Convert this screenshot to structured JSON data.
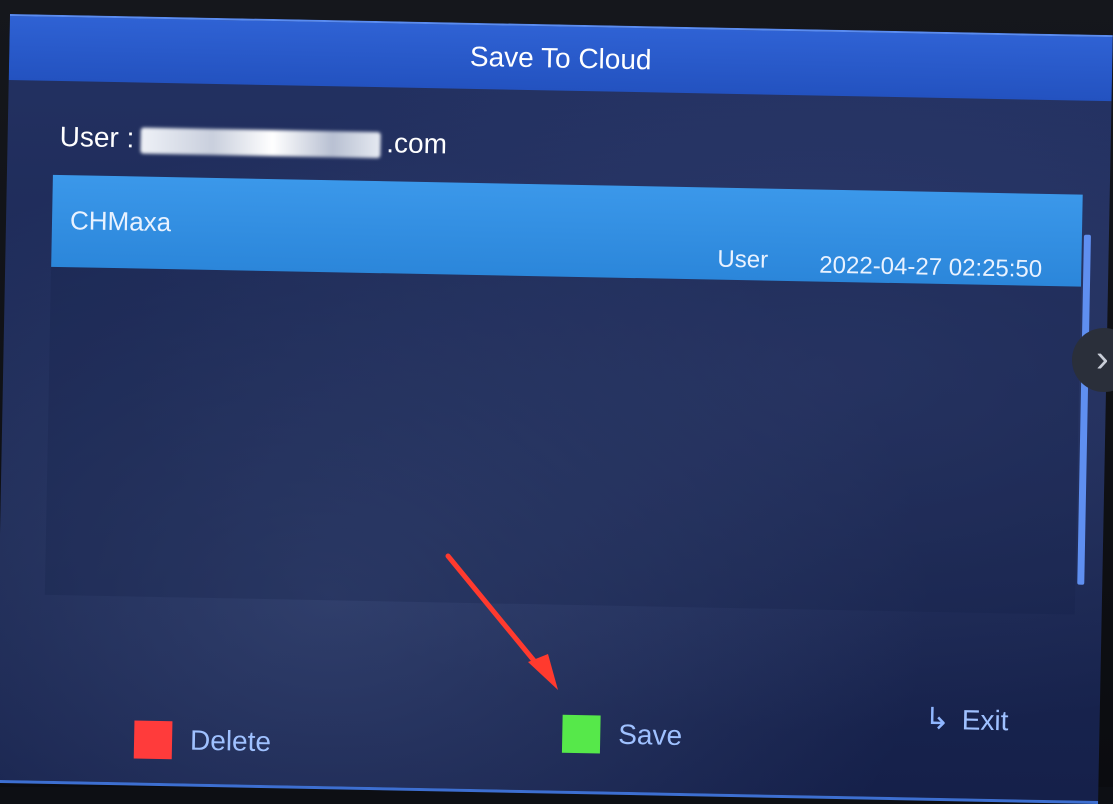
{
  "dialog": {
    "title": "Save To Cloud",
    "user_label": "User : ",
    "user_value_visible": ".com"
  },
  "list": {
    "items": [
      {
        "name": "CHMaxa",
        "type": "User",
        "datetime": "2022-04-27 02:25:50",
        "selected": true
      }
    ]
  },
  "footer": {
    "delete_label": "Delete",
    "save_label": "Save",
    "exit_label": "Exit"
  },
  "colors": {
    "titlebar": "#2352c0",
    "selected_row": "#2b86da",
    "delete_swatch": "#ff3b3b",
    "save_swatch": "#56e84a",
    "annotation_arrow": "#ff3a2e"
  },
  "icons": {
    "exit": "return-arrow-icon",
    "side_nav": "chevron-right-icon"
  }
}
